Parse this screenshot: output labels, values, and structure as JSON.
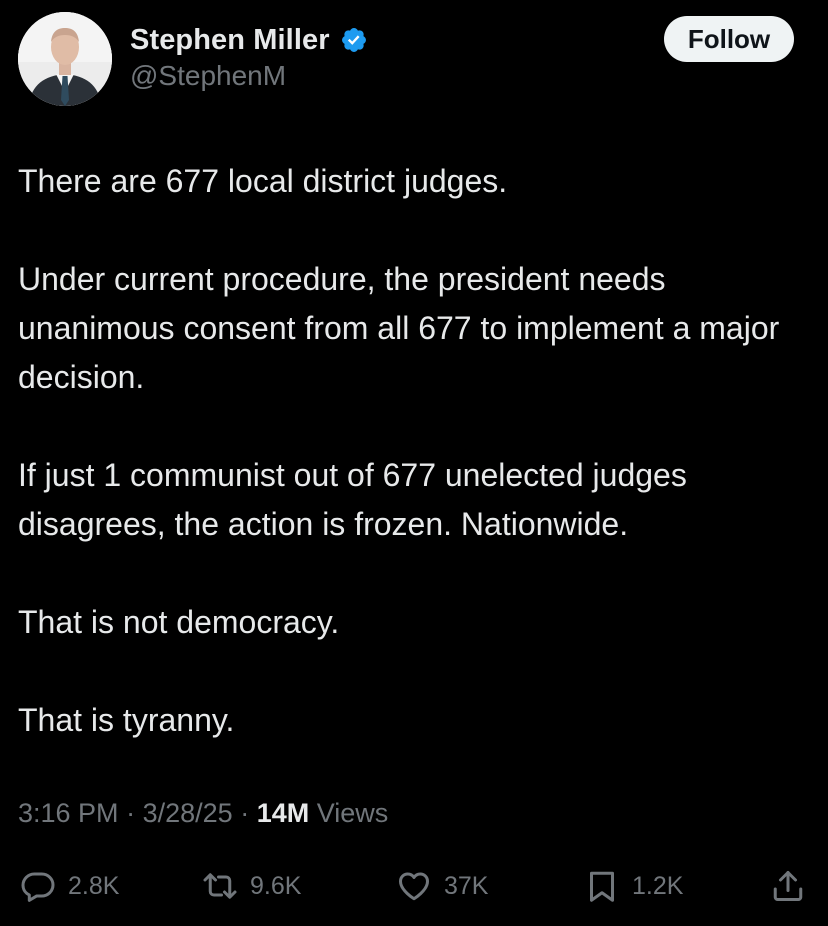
{
  "author": {
    "display_name": "Stephen Miller",
    "handle": "@StephenM",
    "verified_color": "#1d9bf0"
  },
  "header": {
    "follow_label": "Follow"
  },
  "tweet": {
    "paragraphs": [
      "There are 677 local district judges.",
      "Under current procedure, the president needs unanimous consent from all 677 to implement a major decision.",
      "If just 1 communist out of 677 unelected judges disagrees, the action is frozen. Nationwide.",
      "That is not democracy.",
      "That is tyranny."
    ]
  },
  "meta": {
    "time": "3:16 PM",
    "separator": "·",
    "date": "3/28/25",
    "views_count": "14M",
    "views_label": "Views"
  },
  "actions": {
    "replies": {
      "icon": "reply-icon",
      "count": "2.8K"
    },
    "reposts": {
      "icon": "repost-icon",
      "count": "9.6K"
    },
    "likes": {
      "icon": "heart-icon",
      "count": "37K"
    },
    "bookmarks": {
      "icon": "bookmark-icon",
      "count": "1.2K"
    },
    "share": {
      "icon": "share-icon"
    }
  },
  "colors": {
    "background": "#000000",
    "primary_text": "#e7e9ea",
    "secondary_text": "#71767b",
    "follow_button_bg": "#eff3f4",
    "follow_button_text": "#0f1419"
  }
}
